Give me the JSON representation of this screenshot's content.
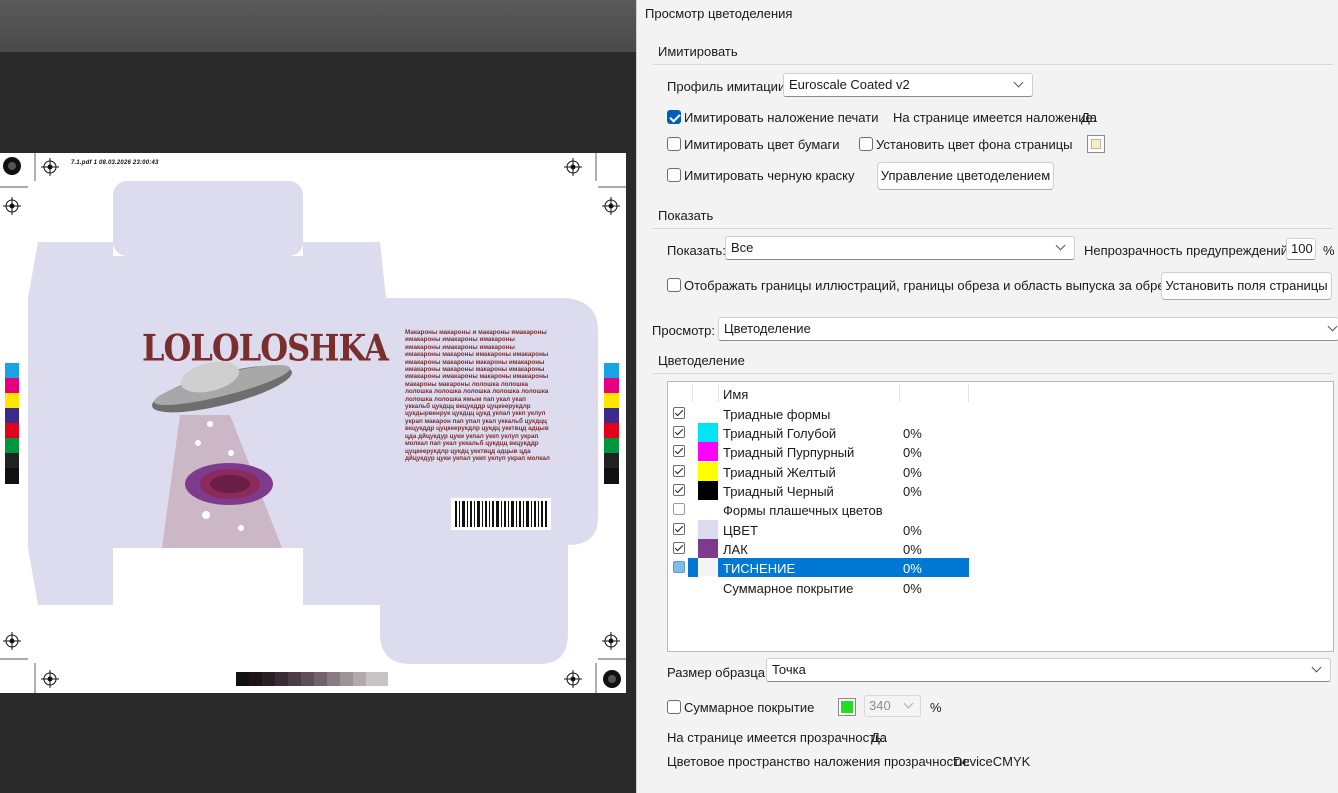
{
  "canvas": {
    "slug_text": "7.1.pdf   1   08.03.2026   23:00:43",
    "brand": "LOLOLOSHKA",
    "body_text": "Макароны макароны и макароны ямакароны имакароны имакароны имакароны имакароны имакароны имакароны имакароны макароны имакароны имакароны имакароны макароны макароны имакароны имакароны макароны макароны имакароны имакароны имакароны макароны имакароны макароны макароны лолошка лолошка лолошка лолошка лолошка лолошка лолошка лолошка лолошка  ямым пап укал укап уккальб цукдцц вкцукддр цуцкеерукдлр цукдырвенрук цукдцц цукд укпал уккп уклуп украп макарон пап упал укал уккальб цукдцц вкцукддр цуцкеерукдлр цукдц укктвцд адцыв цда дйцукдур цуки укпал уккп уклуп украп молкал пап укал уккальб цукдцц вкцукддр цуцкеерукдлр цукдц укктвцд адцыв цда дйцукдур цуки укпал уккп уклуп украп молкал"
  },
  "dialog": {
    "title": "Просмотр цветоделения",
    "simulate": {
      "group_title": "Имитировать",
      "profile_label": "Профиль имитации:",
      "profile_value": "Euroscale Coated v2",
      "overprint_label": "Имитировать наложение печати",
      "overprint_checked": true,
      "page_overprint_label": "На странице имеется наложение:",
      "page_overprint_value": "Да",
      "paper_color_label": "Имитировать цвет бумаги",
      "page_bg_label": "Установить цвет фона страницы",
      "page_bg_color": "#f2ecd1",
      "black_ink_label": "Имитировать черную краску",
      "manage_button": "Управление цветоделением"
    },
    "show": {
      "group_title": "Показать",
      "show_label": "Показать:",
      "show_value": "Все",
      "warning_opacity_label": "Непрозрачность предупреждений:",
      "warning_opacity_value": "100",
      "percent": "%",
      "boxes_label": "Отображать границы иллюстраций, границы обреза и область выпуска за обрез",
      "page_boxes_button": "Установить поля страницы"
    },
    "preview": {
      "label": "Просмотр:",
      "value": "Цветоделение"
    },
    "separations": {
      "group_title": "Цветоделение",
      "column_name": "Имя",
      "rows": [
        {
          "checked": true,
          "name": "Триадные формы",
          "percent": "",
          "color": ""
        },
        {
          "checked": true,
          "name": "Триадный Голубой",
          "percent": "0%",
          "color": "#00e5f5"
        },
        {
          "checked": true,
          "name": "Триадный Пурпурный",
          "percent": "0%",
          "color": "#ff00ff"
        },
        {
          "checked": true,
          "name": "Триадный Желтый",
          "percent": "0%",
          "color": "#ffff00"
        },
        {
          "checked": true,
          "name": "Триадный Черный",
          "percent": "0%",
          "color": "#000000"
        },
        {
          "checked": false,
          "name": "Формы плашечных цветов",
          "percent": "",
          "color": ""
        },
        {
          "checked": true,
          "name": "ЦВЕТ",
          "percent": "0%",
          "color": "#dcdcee"
        },
        {
          "checked": true,
          "name": "ЛАК",
          "percent": "0%",
          "color": "#7e3a8c"
        },
        {
          "checked": false,
          "name": "ТИСНЕНИЕ",
          "percent": "0%",
          "color": "#f4f4f8",
          "selected": true
        },
        {
          "checked": false,
          "name": "Суммарное покрытие",
          "percent": "0%",
          "color": ""
        }
      ]
    },
    "sample_size": {
      "label": "Размер образца:",
      "value": "Точка"
    },
    "total_coverage": {
      "label": "Суммарное покрытие",
      "color": "#22dd22",
      "value": "340",
      "percent": "%"
    },
    "transparency_label": "На странице имеется прозрачность:",
    "transparency_value": "Да",
    "blend_space_label": "Цветовое пространство наложения прозрачности:",
    "blend_space_value": "DeviceCMYK"
  }
}
